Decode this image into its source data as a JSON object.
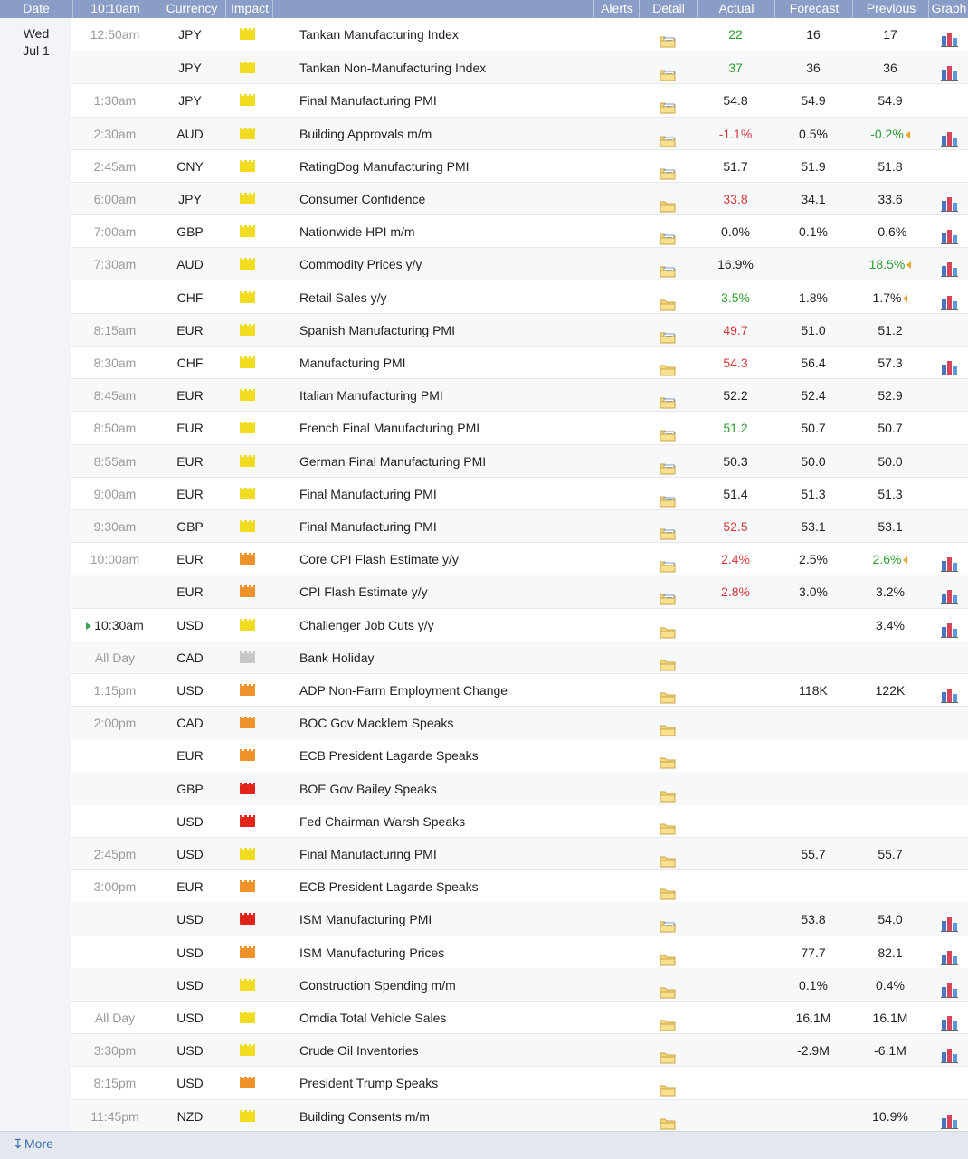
{
  "header": {
    "date": "Date",
    "time": "10:10am",
    "currency": "Currency",
    "impact": "Impact",
    "alerts": "Alerts",
    "detail": "Detail",
    "actual": "Actual",
    "forecast": "Forecast",
    "previous": "Previous",
    "graph": "Graph"
  },
  "day": {
    "weekday": "Wed",
    "date": "Jul 1"
  },
  "colors": {
    "low_impact": "#f2dc1f",
    "medium_impact": "#f0922a",
    "high_impact": "#e3241b",
    "holiday": "#c7c7c7",
    "better": "#2e9e2e",
    "worse": "#d43a3a",
    "header_bg": "#8a9dc6"
  },
  "events": [
    {
      "time": "12:50am",
      "currency": "JPY",
      "impact": "low",
      "event": "Tankan Manufacturing Index",
      "detail_icon": "folder-detail-icon",
      "actual": "22",
      "actual_dir": "up",
      "forecast": "16",
      "previous": "17",
      "previous_dir": "",
      "graph": true
    },
    {
      "time": "",
      "currency": "JPY",
      "impact": "low",
      "event": "Tankan Non-Manufacturing Index",
      "detail_icon": "folder-detail-icon",
      "actual": "37",
      "actual_dir": "up",
      "forecast": "36",
      "previous": "36",
      "previous_dir": "",
      "graph": true
    },
    {
      "time": "1:30am",
      "currency": "JPY",
      "impact": "low",
      "event": "Final Manufacturing PMI",
      "detail_icon": "folder-detail-icon",
      "actual": "54.8",
      "actual_dir": "",
      "forecast": "54.9",
      "previous": "54.9",
      "previous_dir": "",
      "graph": false
    },
    {
      "time": "2:30am",
      "currency": "AUD",
      "impact": "low",
      "event": "Building Approvals m/m",
      "detail_icon": "folder-detail-icon",
      "actual": "-1.1%",
      "actual_dir": "down",
      "forecast": "0.5%",
      "previous": "-0.2%",
      "previous_dir": "up",
      "graph": true
    },
    {
      "time": "2:45am",
      "currency": "CNY",
      "impact": "low",
      "event": "RatingDog Manufacturing PMI",
      "detail_icon": "folder-detail-icon",
      "actual": "51.7",
      "actual_dir": "",
      "forecast": "51.9",
      "previous": "51.8",
      "previous_dir": "",
      "graph": false
    },
    {
      "time": "6:00am",
      "currency": "JPY",
      "impact": "low",
      "event": "Consumer Confidence",
      "detail_icon": "folder-icon",
      "actual": "33.8",
      "actual_dir": "down",
      "forecast": "34.1",
      "previous": "33.6",
      "previous_dir": "",
      "graph": true
    },
    {
      "time": "7:00am",
      "currency": "GBP",
      "impact": "low",
      "event": "Nationwide HPI m/m",
      "detail_icon": "folder-detail-icon",
      "actual": "0.0%",
      "actual_dir": "",
      "forecast": "0.1%",
      "previous": "-0.6%",
      "previous_dir": "",
      "graph": true
    },
    {
      "time": "7:30am",
      "currency": "AUD",
      "impact": "low",
      "event": "Commodity Prices y/y",
      "detail_icon": "folder-detail-icon",
      "actual": "16.9%",
      "actual_dir": "",
      "forecast": "",
      "previous": "18.5%",
      "previous_dir": "up",
      "graph": true
    },
    {
      "time": "",
      "currency": "CHF",
      "impact": "low",
      "event": "Retail Sales y/y",
      "detail_icon": "folder-icon",
      "actual": "3.5%",
      "actual_dir": "up",
      "forecast": "1.8%",
      "previous": "1.7%",
      "previous_dir": "rev",
      "graph": true
    },
    {
      "time": "8:15am",
      "currency": "EUR",
      "impact": "low",
      "event": "Spanish Manufacturing PMI",
      "detail_icon": "folder-detail-icon",
      "actual": "49.7",
      "actual_dir": "down",
      "forecast": "51.0",
      "previous": "51.2",
      "previous_dir": "",
      "graph": false
    },
    {
      "time": "8:30am",
      "currency": "CHF",
      "impact": "low",
      "event": "Manufacturing PMI",
      "detail_icon": "folder-icon",
      "actual": "54.3",
      "actual_dir": "down",
      "forecast": "56.4",
      "previous": "57.3",
      "previous_dir": "",
      "graph": true
    },
    {
      "time": "8:45am",
      "currency": "EUR",
      "impact": "low",
      "event": "Italian Manufacturing PMI",
      "detail_icon": "folder-detail-icon",
      "actual": "52.2",
      "actual_dir": "",
      "forecast": "52.4",
      "previous": "52.9",
      "previous_dir": "",
      "graph": false
    },
    {
      "time": "8:50am",
      "currency": "EUR",
      "impact": "low",
      "event": "French Final Manufacturing PMI",
      "detail_icon": "folder-detail-icon",
      "actual": "51.2",
      "actual_dir": "up",
      "forecast": "50.7",
      "previous": "50.7",
      "previous_dir": "",
      "graph": false
    },
    {
      "time": "8:55am",
      "currency": "EUR",
      "impact": "low",
      "event": "German Final Manufacturing PMI",
      "detail_icon": "folder-detail-icon",
      "actual": "50.3",
      "actual_dir": "",
      "forecast": "50.0",
      "previous": "50.0",
      "previous_dir": "",
      "graph": false
    },
    {
      "time": "9:00am",
      "currency": "EUR",
      "impact": "low",
      "event": "Final Manufacturing PMI",
      "detail_icon": "folder-detail-icon",
      "actual": "51.4",
      "actual_dir": "",
      "forecast": "51.3",
      "previous": "51.3",
      "previous_dir": "",
      "graph": false
    },
    {
      "time": "9:30am",
      "currency": "GBP",
      "impact": "low",
      "event": "Final Manufacturing PMI",
      "detail_icon": "folder-detail-icon",
      "actual": "52.5",
      "actual_dir": "down",
      "forecast": "53.1",
      "previous": "53.1",
      "previous_dir": "",
      "graph": false
    },
    {
      "time": "10:00am",
      "currency": "EUR",
      "impact": "med",
      "event": "Core CPI Flash Estimate y/y",
      "detail_icon": "folder-detail-icon",
      "actual": "2.4%",
      "actual_dir": "down",
      "forecast": "2.5%",
      "previous": "2.6%",
      "previous_dir": "up",
      "graph": true
    },
    {
      "time": "",
      "currency": "EUR",
      "impact": "med",
      "event": "CPI Flash Estimate y/y",
      "detail_icon": "folder-detail-icon",
      "actual": "2.8%",
      "actual_dir": "down",
      "forecast": "3.0%",
      "previous": "3.2%",
      "previous_dir": "",
      "graph": true
    },
    {
      "time": "10:30am",
      "current": true,
      "currency": "USD",
      "impact": "low",
      "event": "Challenger Job Cuts y/y",
      "detail_icon": "folder-icon",
      "actual": "",
      "actual_dir": "",
      "forecast": "",
      "previous": "3.4%",
      "previous_dir": "",
      "graph": true
    },
    {
      "time": "All Day",
      "currency": "CAD",
      "impact": "hol",
      "event": "Bank Holiday",
      "detail_icon": "folder-icon",
      "actual": "",
      "actual_dir": "",
      "forecast": "",
      "previous": "",
      "previous_dir": "",
      "graph": false
    },
    {
      "time": "1:15pm",
      "currency": "USD",
      "impact": "med",
      "event": "ADP Non-Farm Employment Change",
      "detail_icon": "folder-icon",
      "actual": "",
      "actual_dir": "",
      "forecast": "118K",
      "previous": "122K",
      "previous_dir": "",
      "graph": true
    },
    {
      "time": "2:00pm",
      "currency": "CAD",
      "impact": "med",
      "event": "BOC Gov Macklem Speaks",
      "detail_icon": "folder-icon",
      "actual": "",
      "actual_dir": "",
      "forecast": "",
      "previous": "",
      "previous_dir": "",
      "graph": false
    },
    {
      "time": "",
      "currency": "EUR",
      "impact": "med",
      "event": "ECB President Lagarde Speaks",
      "detail_icon": "folder-icon",
      "actual": "",
      "actual_dir": "",
      "forecast": "",
      "previous": "",
      "previous_dir": "",
      "graph": false
    },
    {
      "time": "",
      "currency": "GBP",
      "impact": "high",
      "event": "BOE Gov Bailey Speaks",
      "detail_icon": "folder-icon",
      "actual": "",
      "actual_dir": "",
      "forecast": "",
      "previous": "",
      "previous_dir": "",
      "graph": false
    },
    {
      "time": "",
      "currency": "USD",
      "impact": "high",
      "event": "Fed Chairman Warsh Speaks",
      "detail_icon": "folder-icon",
      "actual": "",
      "actual_dir": "",
      "forecast": "",
      "previous": "",
      "previous_dir": "",
      "graph": false
    },
    {
      "time": "2:45pm",
      "currency": "USD",
      "impact": "low",
      "event": "Final Manufacturing PMI",
      "detail_icon": "folder-icon",
      "actual": "",
      "actual_dir": "",
      "forecast": "55.7",
      "previous": "55.7",
      "previous_dir": "",
      "graph": false
    },
    {
      "time": "3:00pm",
      "currency": "EUR",
      "impact": "med",
      "event": "ECB President Lagarde Speaks",
      "detail_icon": "folder-icon",
      "actual": "",
      "actual_dir": "",
      "forecast": "",
      "previous": "",
      "previous_dir": "",
      "graph": false
    },
    {
      "time": "",
      "currency": "USD",
      "impact": "high",
      "event": "ISM Manufacturing PMI",
      "detail_icon": "folder-detail-icon",
      "actual": "",
      "actual_dir": "",
      "forecast": "53.8",
      "previous": "54.0",
      "previous_dir": "",
      "graph": true
    },
    {
      "time": "",
      "currency": "USD",
      "impact": "med",
      "event": "ISM Manufacturing Prices",
      "detail_icon": "folder-icon",
      "actual": "",
      "actual_dir": "",
      "forecast": "77.7",
      "previous": "82.1",
      "previous_dir": "",
      "graph": true
    },
    {
      "time": "",
      "currency": "USD",
      "impact": "low",
      "event": "Construction Spending m/m",
      "detail_icon": "folder-icon",
      "actual": "",
      "actual_dir": "",
      "forecast": "0.1%",
      "previous": "0.4%",
      "previous_dir": "",
      "graph": true
    },
    {
      "time": "All Day",
      "currency": "USD",
      "impact": "low",
      "event": "Omdia Total Vehicle Sales",
      "detail_icon": "folder-icon",
      "actual": "",
      "actual_dir": "",
      "forecast": "16.1M",
      "previous": "16.1M",
      "previous_dir": "",
      "graph": true
    },
    {
      "time": "3:30pm",
      "currency": "USD",
      "impact": "low",
      "event": "Crude Oil Inventories",
      "detail_icon": "folder-icon",
      "actual": "",
      "actual_dir": "",
      "forecast": "-2.9M",
      "previous": "-6.1M",
      "previous_dir": "",
      "graph": true
    },
    {
      "time": "8:15pm",
      "currency": "USD",
      "impact": "med",
      "event": "President Trump Speaks",
      "detail_icon": "folder-icon",
      "actual": "",
      "actual_dir": "",
      "forecast": "",
      "previous": "",
      "previous_dir": "",
      "graph": false
    },
    {
      "time": "11:45pm",
      "currency": "NZD",
      "impact": "low",
      "event": "Building Consents m/m",
      "detail_icon": "folder-icon",
      "actual": "",
      "actual_dir": "",
      "forecast": "",
      "previous": "10.9%",
      "previous_dir": "",
      "graph": true
    }
  ],
  "footer": {
    "more_label": "More",
    "more_icon": "arrow-down-icon"
  }
}
